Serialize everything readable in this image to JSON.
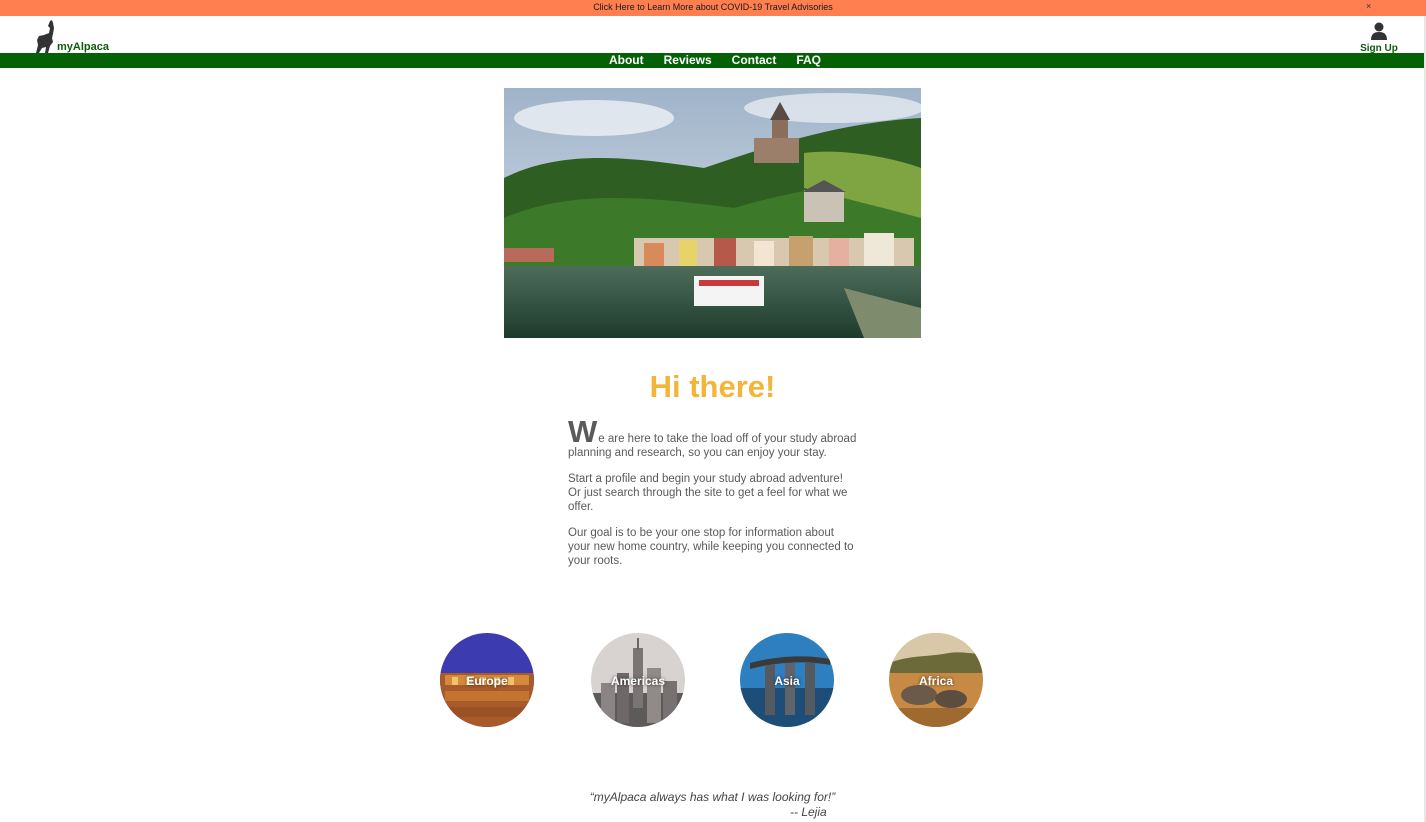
{
  "banner": {
    "text": "Click Here to Learn More about COVID-19 Travel Advisories",
    "close_label": "×"
  },
  "header": {
    "logo_text": "myAlpaca",
    "logo_icon": "alpaca-icon",
    "signup_icon": "user-icon",
    "signup_label": "Sign Up"
  },
  "nav": {
    "items": [
      {
        "label": "About"
      },
      {
        "label": "Reviews"
      },
      {
        "label": "Contact"
      },
      {
        "label": "FAQ"
      }
    ]
  },
  "main": {
    "hero_image": "castle-river-town-photo",
    "greeting": "Hi there!",
    "dropcap": "W",
    "paragraph_1": "e are here to take the load off of your study abroad planning and research, so you can enjoy your stay.",
    "paragraph_2": "Start a profile and begin your study abroad adventure! Or just search through the site to get a feel for what we offer.",
    "paragraph_3": "Our goal is to be your one stop for information about your new home country, while keeping you connected to your roots."
  },
  "regions": [
    {
      "label": "Europe",
      "image": "colosseum-photo"
    },
    {
      "label": "Americas",
      "image": "city-skyline-photo"
    },
    {
      "label": "Asia",
      "image": "marina-bay-photo"
    },
    {
      "label": "Africa",
      "image": "rhinos-savanna-photo"
    }
  ],
  "testimonial": {
    "quote": "“myAlpaca always has what I was looking for!”",
    "author": "-- Lejia"
  },
  "colors": {
    "banner": "#ff7f50",
    "nav": "#056105",
    "brand_green": "#0d5c0d",
    "greeting": "#f4b43a"
  }
}
